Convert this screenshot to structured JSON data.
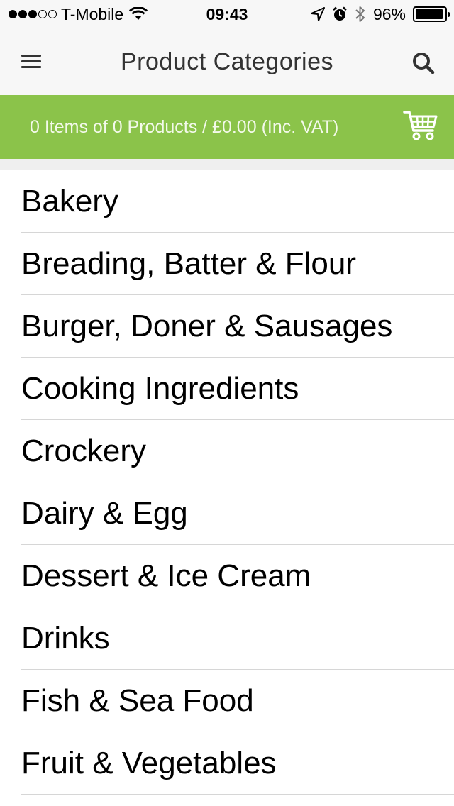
{
  "status_bar": {
    "signal_filled": 3,
    "signal_total": 5,
    "carrier": "T-Mobile",
    "time": "09:43",
    "battery_percent": "96%",
    "battery_level": 0.96,
    "icons": [
      "wifi-icon",
      "location-arrow-icon",
      "alarm-icon",
      "bluetooth-icon",
      "battery-icon"
    ]
  },
  "nav": {
    "title": "Product Categories",
    "icons": [
      "menu-icon",
      "search-icon"
    ]
  },
  "cart": {
    "summary": "0 Items of 0 Products / £0.00 (Inc. VAT)",
    "icon": "cart-icon",
    "color": "#8bc34a"
  },
  "categories": [
    "Bakery",
    "Breading, Batter & Flour",
    "Burger, Doner & Sausages",
    "Cooking Ingredients",
    "Crockery",
    "Dairy & Egg",
    "Dessert & Ice Cream",
    "Drinks",
    "Fish & Sea Food",
    "Fruit & Vegetables"
  ]
}
